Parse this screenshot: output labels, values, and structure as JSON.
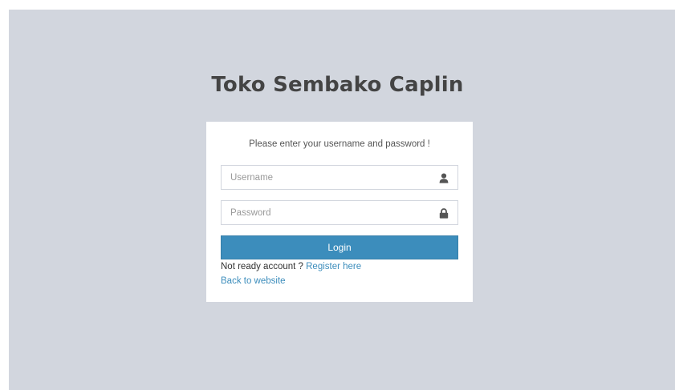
{
  "header": {
    "title": "Toko Sembako Caplin"
  },
  "login": {
    "message": "Please enter your username and password !",
    "username": {
      "placeholder": "Username",
      "value": "",
      "icon": "user-icon"
    },
    "password": {
      "placeholder": "Password",
      "value": "",
      "icon": "lock-icon"
    },
    "submit_label": "Login",
    "register_prompt": "Not ready account ?",
    "register_link": "Register here",
    "back_link": "Back to website"
  },
  "colors": {
    "background": "#d2d6de",
    "accent": "#3c8dbc",
    "title": "#444444"
  }
}
